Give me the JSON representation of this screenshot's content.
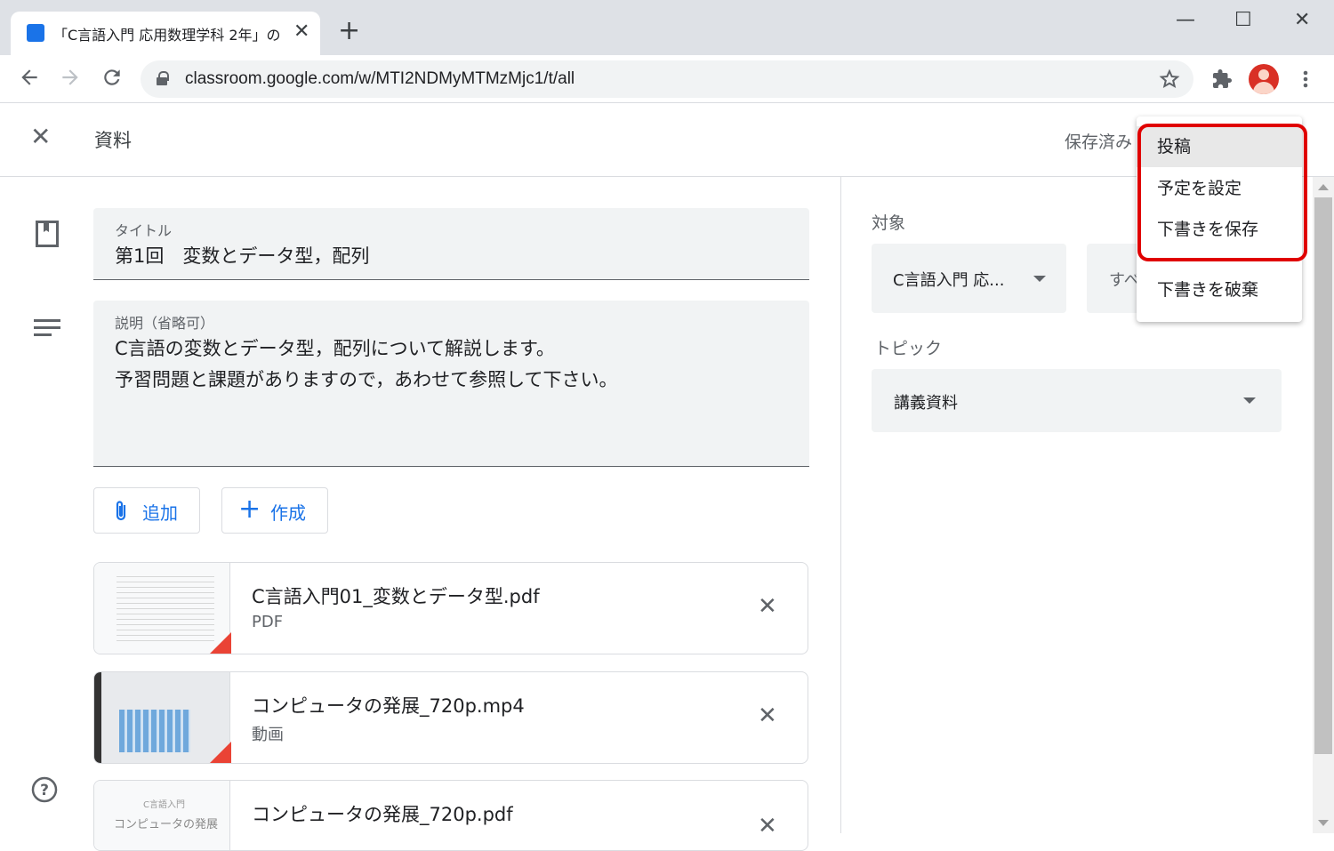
{
  "browser": {
    "tab_title": "「C言語入門 応用数理学科 2年」の",
    "tab_close": "✕",
    "new_tab": "+",
    "url": "classroom.google.com/w/MTI2NDMyMTMzMjc1/t/all",
    "window_controls": [
      "—",
      "☐",
      "✕"
    ]
  },
  "header": {
    "close": "✕",
    "title": "資料",
    "save_status": "保存済み"
  },
  "form": {
    "title_label": "タイトル",
    "title_value": "第1回　変数とデータ型，配列",
    "desc_label": "説明（省略可）",
    "desc_line1": "C言語の変数とデータ型，配列について解説します。",
    "desc_line2": "予習問題と課題がありますので，あわせて参照して下さい。",
    "add_label": "追加",
    "create_label": "作成"
  },
  "attachments": [
    {
      "name": "C言語入門01_変数とデータ型.pdf",
      "type": "PDF"
    },
    {
      "name": "コンピュータの発展_720p.mp4",
      "type": "動画"
    },
    {
      "name": "コンピュータの発展_720p.pdf",
      "type": ""
    }
  ],
  "thumb_text": {
    "line1": "C言語入門",
    "line2": "コンピュータの発展"
  },
  "right": {
    "target_label": "対象",
    "class_select": "C言語入門 応...",
    "students_select": "すべ",
    "topic_label": "トピック",
    "topic_select": "講義資料"
  },
  "menu": {
    "items": [
      "投稿",
      "予定を設定",
      "下書きを保存",
      "下書きを破棄"
    ]
  },
  "colors": {
    "accent": "#1a73e8",
    "highlight": "#e00000"
  }
}
